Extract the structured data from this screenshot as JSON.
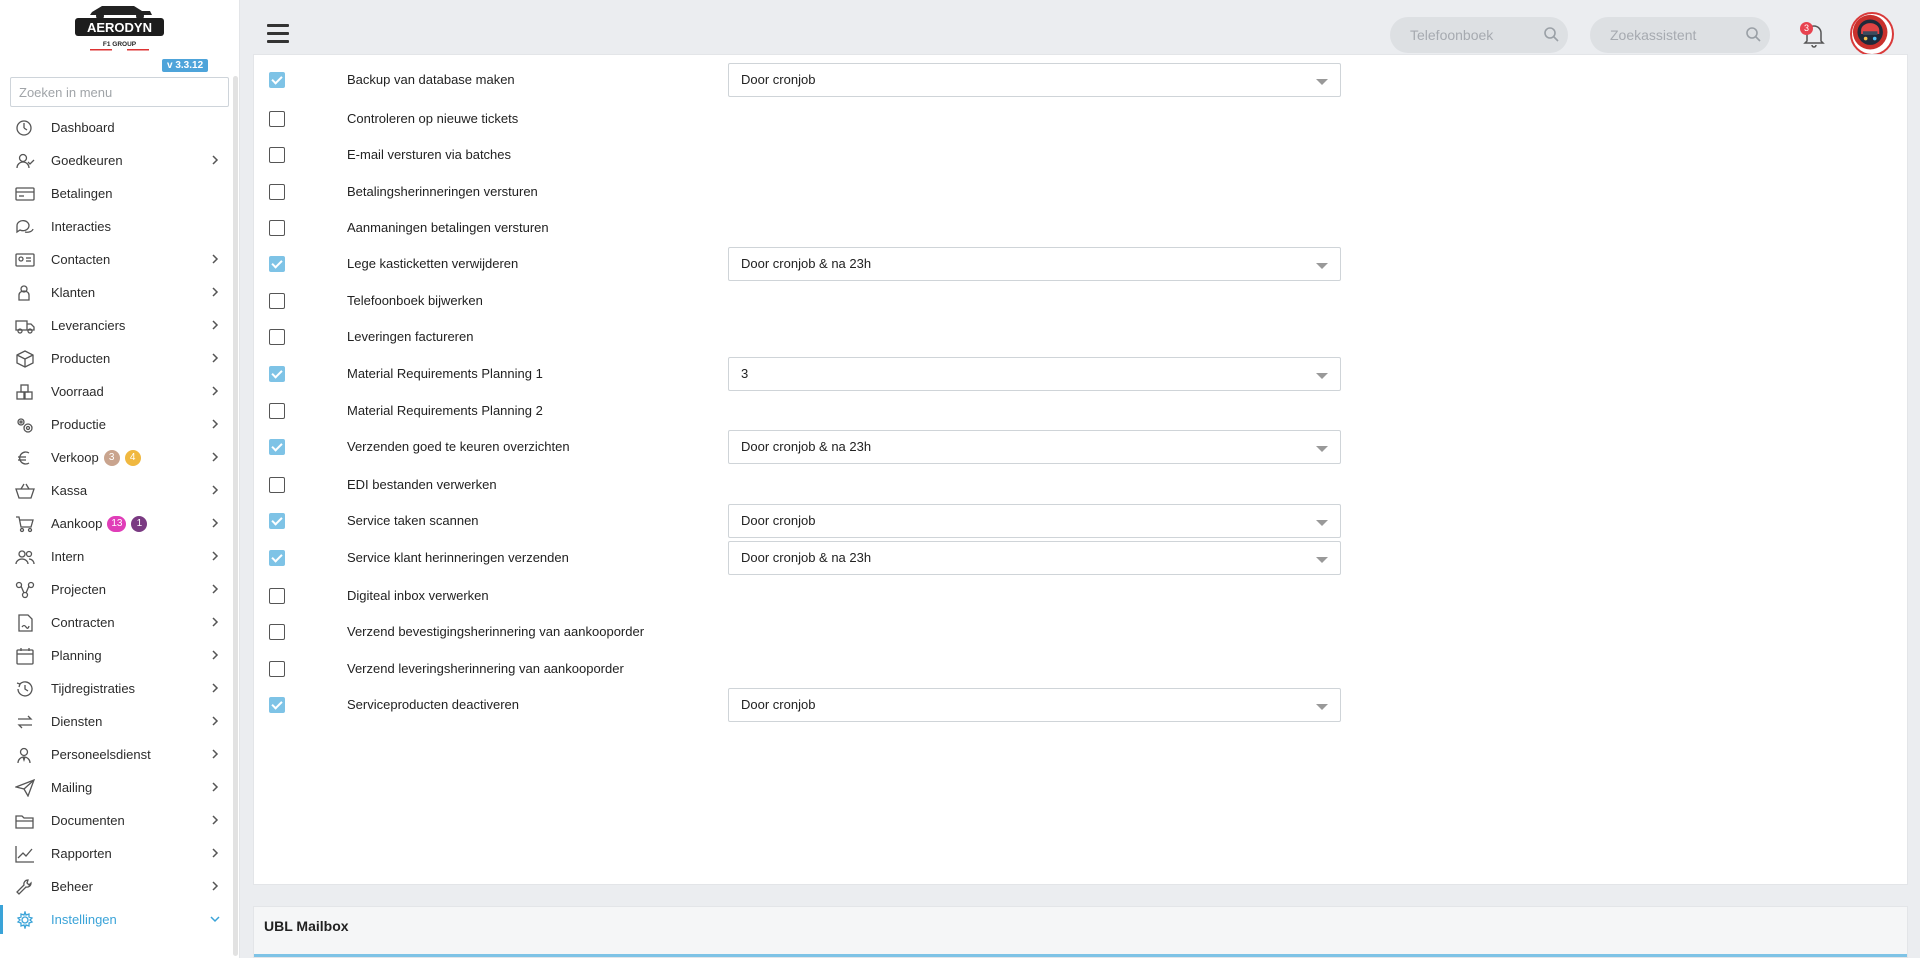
{
  "app": {
    "logo_text": "AERODYN",
    "logo_subtext": "F1 GROUP",
    "version": "v 3.3.12"
  },
  "sidebar": {
    "search_placeholder": "Zoeken in menu",
    "items": [
      {
        "label": "Dashboard",
        "icon": "dashboard-icon",
        "chevron": false
      },
      {
        "label": "Goedkeuren",
        "icon": "user-check-icon",
        "chevron": true
      },
      {
        "label": "Betalingen",
        "icon": "credit-card-icon",
        "chevron": false
      },
      {
        "label": "Interacties",
        "icon": "chat-icon",
        "chevron": false
      },
      {
        "label": "Contacten",
        "icon": "contact-card-icon",
        "chevron": true
      },
      {
        "label": "Klanten",
        "icon": "customer-icon",
        "chevron": true
      },
      {
        "label": "Leveranciers",
        "icon": "truck-icon",
        "chevron": true
      },
      {
        "label": "Producten",
        "icon": "box-icon",
        "chevron": true
      },
      {
        "label": "Voorraad",
        "icon": "boxes-icon",
        "chevron": true
      },
      {
        "label": "Productie",
        "icon": "gears-icon",
        "chevron": true
      },
      {
        "label": "Verkoop",
        "icon": "euro-icon",
        "chevron": true,
        "badges": [
          {
            "text": "3",
            "color": "#c9a48e"
          },
          {
            "text": "4",
            "color": "#f0b840"
          }
        ]
      },
      {
        "label": "Kassa",
        "icon": "basket-icon",
        "chevron": true
      },
      {
        "label": "Aankoop",
        "icon": "cart-icon",
        "chevron": true,
        "badges": [
          {
            "text": "13",
            "color": "#e03db8"
          },
          {
            "text": "1",
            "color": "#7a3a82"
          }
        ]
      },
      {
        "label": "Intern",
        "icon": "users-icon",
        "chevron": true
      },
      {
        "label": "Projecten",
        "icon": "project-icon",
        "chevron": true
      },
      {
        "label": "Contracten",
        "icon": "contract-icon",
        "chevron": true
      },
      {
        "label": "Planning",
        "icon": "calendar-icon",
        "chevron": true
      },
      {
        "label": "Tijdregistraties",
        "icon": "clock-icon",
        "chevron": true
      },
      {
        "label": "Diensten",
        "icon": "exchange-icon",
        "chevron": true
      },
      {
        "label": "Personeelsdienst",
        "icon": "staff-icon",
        "chevron": true
      },
      {
        "label": "Mailing",
        "icon": "paper-plane-icon",
        "chevron": true
      },
      {
        "label": "Documenten",
        "icon": "folder-icon",
        "chevron": true
      },
      {
        "label": "Rapporten",
        "icon": "chart-line-icon",
        "chevron": true
      },
      {
        "label": "Beheer",
        "icon": "wrench-icon",
        "chevron": true
      },
      {
        "label": "Instellingen",
        "icon": "gear-icon",
        "chevron": true,
        "active": true
      }
    ]
  },
  "topbar": {
    "phonebook_placeholder": "Telefoonboek",
    "assistant_placeholder": "Zoekassistent",
    "notification_count": "3"
  },
  "tasks": [
    {
      "label": "Backup van database maken",
      "checked": true,
      "select": "Door cronjob"
    },
    {
      "label": "Controleren op nieuwe tickets",
      "checked": false,
      "select": null
    },
    {
      "label": "E-mail versturen via batches",
      "checked": false,
      "select": null
    },
    {
      "label": "Betalingsherinneringen versturen",
      "checked": false,
      "select": null
    },
    {
      "label": "Aanmaningen betalingen versturen",
      "checked": false,
      "select": null
    },
    {
      "label": "Lege kasticketten verwijderen",
      "checked": true,
      "select": "Door cronjob & na 23h"
    },
    {
      "label": "Telefoonboek bijwerken",
      "checked": false,
      "select": null
    },
    {
      "label": "Leveringen factureren",
      "checked": false,
      "select": null
    },
    {
      "label": "Material Requirements Planning 1",
      "checked": true,
      "select": "3"
    },
    {
      "label": "Material Requirements Planning 2",
      "checked": false,
      "select": null
    },
    {
      "label": "Verzenden goed te keuren overzichten",
      "checked": true,
      "select": "Door cronjob & na 23h"
    },
    {
      "label": "EDI bestanden verwerken",
      "checked": false,
      "select": null
    },
    {
      "label": "Service taken scannen",
      "checked": true,
      "select": "Door cronjob"
    },
    {
      "label": "Service klant herinneringen verzenden",
      "checked": true,
      "select": "Door cronjob & na 23h"
    },
    {
      "label": "Digiteal inbox verwerken",
      "checked": false,
      "select": null
    },
    {
      "label": "Verzend bevestigingsherinnering van aankooporder",
      "checked": false,
      "select": null
    },
    {
      "label": "Verzend leveringsherinnering van aankooporder",
      "checked": false,
      "select": null
    },
    {
      "label": "Serviceproducten deactiveren",
      "checked": true,
      "select": "Door cronjob"
    }
  ],
  "ubl": {
    "title": "UBL Mailbox"
  },
  "colors": {
    "accent": "#3aa3d8",
    "checkbox_checked": "#7ec3e6",
    "notification": "#e8434f"
  }
}
